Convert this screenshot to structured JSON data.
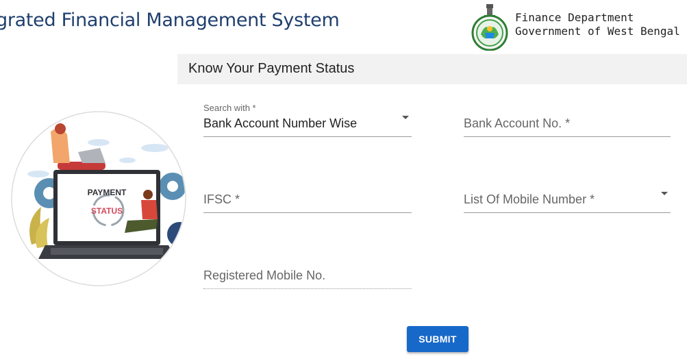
{
  "header": {
    "app_title": "grated Financial Management System",
    "department_line1": "Finance Department",
    "department_line2": "Government of West Bengal"
  },
  "panel": {
    "title": "Know Your Payment Status"
  },
  "illustration": {
    "line1": "PAYMENT",
    "line2": "STATUS"
  },
  "form": {
    "search_with": {
      "label": "Search with *",
      "value": "Bank Account Number Wise"
    },
    "bank_account": {
      "placeholder": "Bank Account No. *"
    },
    "ifsc": {
      "placeholder": "IFSC *"
    },
    "mobile_list": {
      "placeholder": "List Of Mobile Number *"
    },
    "registered_mobile": {
      "placeholder": "Registered Mobile No."
    },
    "submit_label": "SUBMIT"
  },
  "colors": {
    "title_blue": "#1f3f6e",
    "submit_blue": "#1769c9",
    "header_bg": "#f2f2f2"
  }
}
